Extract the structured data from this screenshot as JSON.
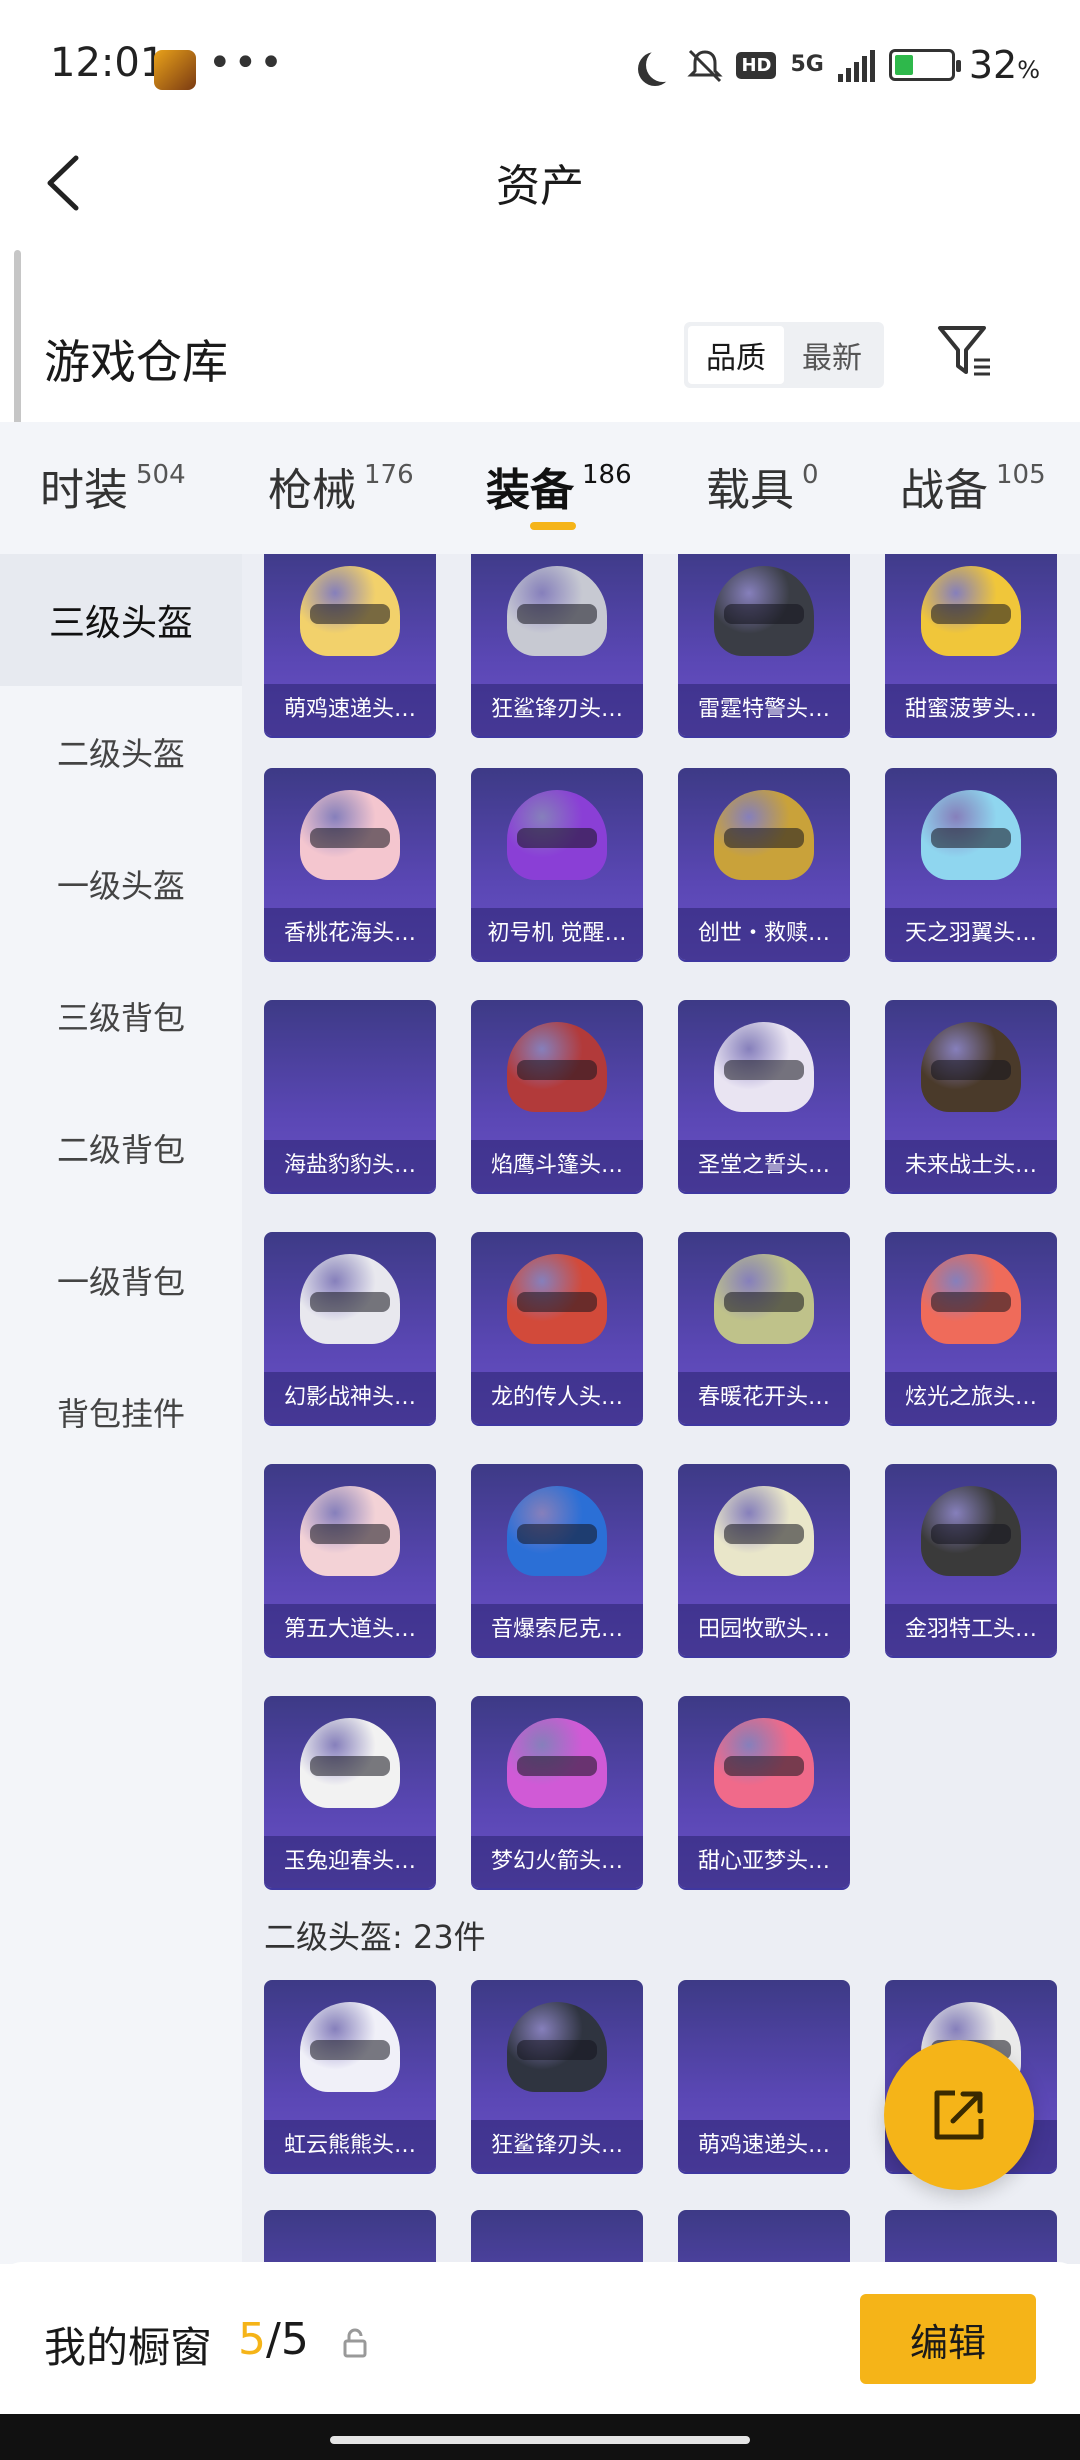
{
  "status_bar": {
    "time": "12:01",
    "dots": "•••",
    "hd": "HD",
    "net": "5G",
    "battery": "32",
    "battery_unit": "%",
    "battery_level": 0.32
  },
  "header": {
    "title": "资产"
  },
  "warehouse": {
    "title": "游戏仓库",
    "sort_options": [
      "品质",
      "最新"
    ],
    "active_sort": "品质"
  },
  "tabs": [
    {
      "label": "时装",
      "count": "504"
    },
    {
      "label": "枪械",
      "count": "176"
    },
    {
      "label": "装备",
      "count": "186",
      "active": true
    },
    {
      "label": "载具",
      "count": "0"
    },
    {
      "label": "战备",
      "count": "105"
    }
  ],
  "side_menu": [
    "三级头盔",
    "二级头盔",
    "一级头盔",
    "三级背包",
    "二级背包",
    "一级背包",
    "背包挂件"
  ],
  "level3_items": [
    "萌鸡速递头…",
    "狂鲨锋刃头…",
    "雷霆特警头…",
    "甜蜜菠萝头…",
    "香桃花海头…",
    "初号机 觉醒…",
    "创世・救赎…",
    "天之羽翼头…",
    "海盐豹豹头…",
    "焰鹰斗篷头…",
    "圣堂之誓头…",
    "未来战士头…",
    "幻影战神头…",
    "龙的传人头…",
    "春暖花开头…",
    "炫光之旅头…",
    "第五大道头…",
    "音爆索尼克…",
    "田园牧歌头…",
    "金羽特工头…",
    "玉兔迎春头…",
    "梦幻火箭头…",
    "甜心亚梦头…"
  ],
  "level2_section": {
    "label": "二级头盔: 23件"
  },
  "level2_items": [
    "虹云熊熊头…",
    "狂鲨锋刃头…",
    "萌鸡速递头…",
    ""
  ],
  "bottom_bar": {
    "label": "我的橱窗",
    "current": "5",
    "total": "/5",
    "edit_label": "编辑"
  },
  "colors": {
    "accent": "#f5b418",
    "card_top": "#3d3a86",
    "card_bottom": "#6a52c6"
  },
  "icons": [
    "back-arrow-icon",
    "filter-icon",
    "share-icon",
    "lock-icon",
    "moon-icon",
    "bell-off-icon",
    "signal-icon",
    "battery-icon"
  ]
}
